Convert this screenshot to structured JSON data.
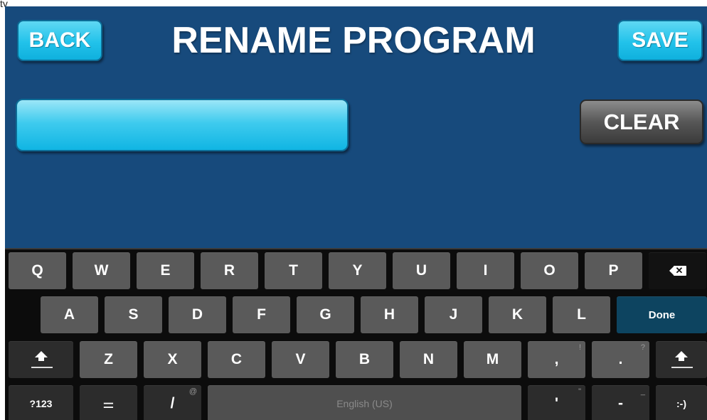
{
  "fragment": "ty",
  "header": {
    "back_label": "BACK",
    "title": "RENAME PROGRAM",
    "save_label": "SAVE"
  },
  "form": {
    "name_value": "",
    "clear_label": "CLEAR"
  },
  "keyboard": {
    "row1": [
      "Q",
      "W",
      "E",
      "R",
      "T",
      "Y",
      "U",
      "I",
      "O",
      "P"
    ],
    "row2": [
      "A",
      "S",
      "D",
      "F",
      "G",
      "H",
      "J",
      "K",
      "L"
    ],
    "done_label": "Done",
    "row3": [
      "Z",
      "X",
      "C",
      "V",
      "B",
      "N",
      "M"
    ],
    "comma": ",",
    "comma_hint": "!",
    "period": ".",
    "period_hint": "?",
    "sym_label": "?123",
    "settings_glyph": "⚌",
    "slash": "/",
    "slash_hint": "@",
    "space_label": "English (US)",
    "apostrophe": "'",
    "apostrophe_hint": "\"",
    "dash": "-",
    "dash_hint": "_",
    "smiley": ":-)"
  }
}
